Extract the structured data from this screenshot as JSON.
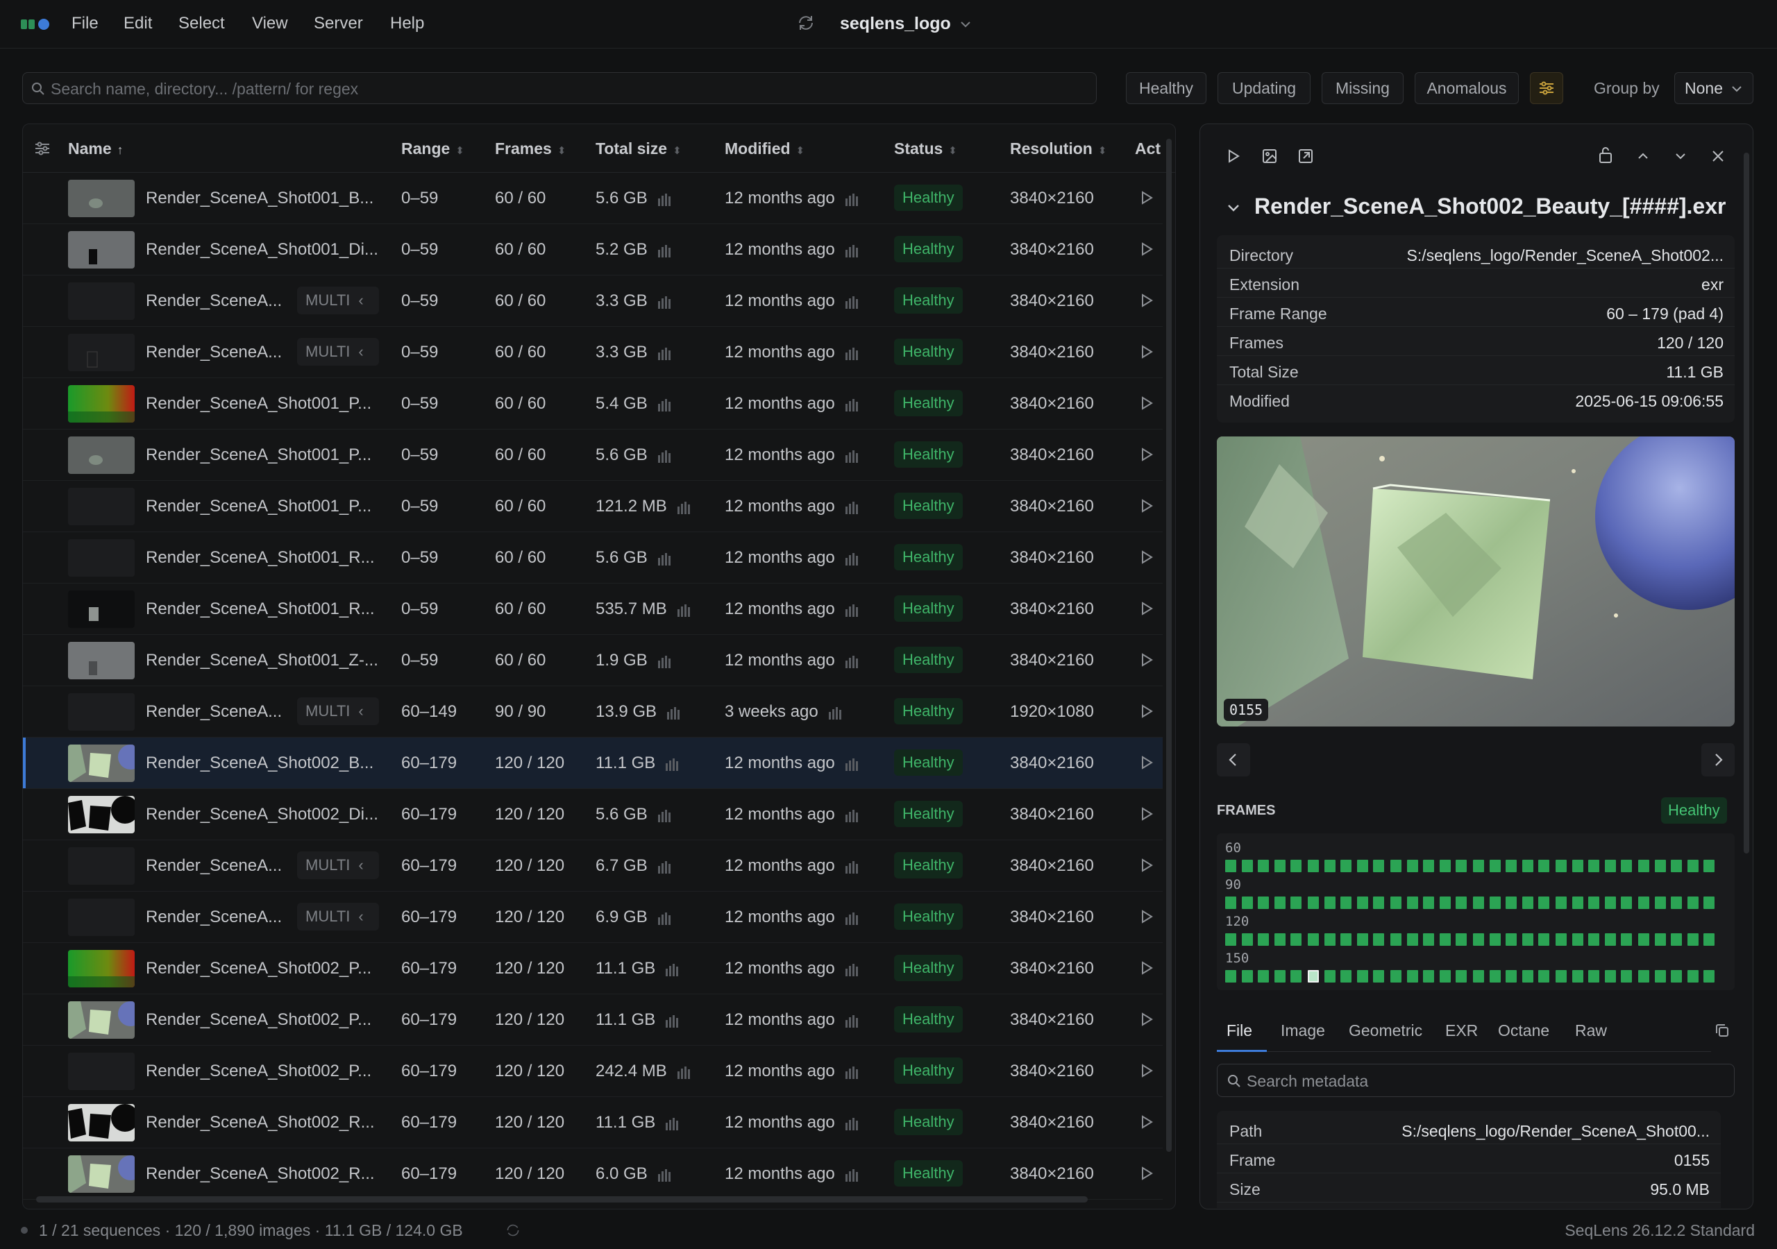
{
  "menubar": {
    "items": [
      "File",
      "Edit",
      "Select",
      "View",
      "Server",
      "Help"
    ],
    "title": "seqlens_logo"
  },
  "toolbar": {
    "search_placeholder": "Search name, directory... /pattern/ for regex",
    "filters": [
      "Healthy",
      "Updating",
      "Missing",
      "Anomalous"
    ],
    "group_by_label": "Group by",
    "group_by_value": "None"
  },
  "table": {
    "columns": [
      "Name",
      "Range",
      "Frames",
      "Total size",
      "Modified",
      "Status",
      "Resolution",
      "Act"
    ],
    "rows": [
      {
        "name": "Render_SceneA_Shot001_B...",
        "multi": "",
        "range": "0–59",
        "frames": "60 / 60",
        "size": "5.6 GB",
        "modified": "12 months ago",
        "status": "Healthy",
        "resolution": "3840×2160",
        "thumb": "orb"
      },
      {
        "name": "Render_SceneA_Shot001_Di...",
        "multi": "",
        "range": "0–59",
        "frames": "60 / 60",
        "size": "5.2 GB",
        "modified": "12 months ago",
        "status": "Healthy",
        "resolution": "3840×2160",
        "thumb": "grey-dark"
      },
      {
        "name": "Render_SceneA...",
        "multi": "MULTI",
        "range": "0–59",
        "frames": "60 / 60",
        "size": "3.3 GB",
        "modified": "12 months ago",
        "status": "Healthy",
        "resolution": "3840×2160",
        "thumb": "black"
      },
      {
        "name": "Render_SceneA...",
        "multi": "MULTI",
        "range": "0–59",
        "frames": "60 / 60",
        "size": "3.3 GB",
        "modified": "12 months ago",
        "status": "Healthy",
        "resolution": "3840×2160",
        "thumb": "black-outline"
      },
      {
        "name": "Render_SceneA_Shot001_P...",
        "multi": "",
        "range": "0–59",
        "frames": "60 / 60",
        "size": "5.4 GB",
        "modified": "12 months ago",
        "status": "Healthy",
        "resolution": "3840×2160",
        "thumb": "rgb"
      },
      {
        "name": "Render_SceneA_Shot001_P...",
        "multi": "",
        "range": "0–59",
        "frames": "60 / 60",
        "size": "5.6 GB",
        "modified": "12 months ago",
        "status": "Healthy",
        "resolution": "3840×2160",
        "thumb": "orb"
      },
      {
        "name": "Render_SceneA_Shot001_P...",
        "multi": "",
        "range": "0–59",
        "frames": "60 / 60",
        "size": "121.2 MB",
        "modified": "12 months ago",
        "status": "Healthy",
        "resolution": "3840×2160",
        "thumb": "black"
      },
      {
        "name": "Render_SceneA_Shot001_R...",
        "multi": "",
        "range": "0–59",
        "frames": "60 / 60",
        "size": "5.6 GB",
        "modified": "12 months ago",
        "status": "Healthy",
        "resolution": "3840×2160",
        "thumb": "black"
      },
      {
        "name": "Render_SceneA_Shot001_R...",
        "multi": "",
        "range": "0–59",
        "frames": "60 / 60",
        "size": "535.7 MB",
        "modified": "12 months ago",
        "status": "Healthy",
        "resolution": "3840×2160",
        "thumb": "black-cube"
      },
      {
        "name": "Render_SceneA_Shot001_Z-...",
        "multi": "",
        "range": "0–59",
        "frames": "60 / 60",
        "size": "1.9 GB",
        "modified": "12 months ago",
        "status": "Healthy",
        "resolution": "3840×2160",
        "thumb": "grey-light"
      },
      {
        "name": "Render_SceneA...",
        "multi": "MULTI",
        "range": "60–149",
        "frames": "90 / 90",
        "size": "13.9 GB",
        "modified": "3 weeks ago",
        "status": "Healthy",
        "resolution": "1920×1080",
        "thumb": "black"
      },
      {
        "name": "Render_SceneA_Shot002_B...",
        "multi": "",
        "range": "60–179",
        "frames": "120 / 120",
        "size": "11.1 GB",
        "modified": "12 months ago",
        "status": "Healthy",
        "resolution": "3840×2160",
        "thumb": "scene",
        "selected": true
      },
      {
        "name": "Render_SceneA_Shot002_Di...",
        "multi": "",
        "range": "60–179",
        "frames": "120 / 120",
        "size": "5.6 GB",
        "modified": "12 months ago",
        "status": "Healthy",
        "resolution": "3840×2160",
        "thumb": "scene-dark"
      },
      {
        "name": "Render_SceneA...",
        "multi": "MULTI",
        "range": "60–179",
        "frames": "120 / 120",
        "size": "6.7 GB",
        "modified": "12 months ago",
        "status": "Healthy",
        "resolution": "3840×2160",
        "thumb": "black"
      },
      {
        "name": "Render_SceneA...",
        "multi": "MULTI",
        "range": "60–179",
        "frames": "120 / 120",
        "size": "6.9 GB",
        "modified": "12 months ago",
        "status": "Healthy",
        "resolution": "3840×2160",
        "thumb": "black"
      },
      {
        "name": "Render_SceneA_Shot002_P...",
        "multi": "",
        "range": "60–179",
        "frames": "120 / 120",
        "size": "11.1 GB",
        "modified": "12 months ago",
        "status": "Healthy",
        "resolution": "3840×2160",
        "thumb": "rgb"
      },
      {
        "name": "Render_SceneA_Shot002_P...",
        "multi": "",
        "range": "60–179",
        "frames": "120 / 120",
        "size": "11.1 GB",
        "modified": "12 months ago",
        "status": "Healthy",
        "resolution": "3840×2160",
        "thumb": "scene"
      },
      {
        "name": "Render_SceneA_Shot002_P...",
        "multi": "",
        "range": "60–179",
        "frames": "120 / 120",
        "size": "242.4 MB",
        "modified": "12 months ago",
        "status": "Healthy",
        "resolution": "3840×2160",
        "thumb": "black"
      },
      {
        "name": "Render_SceneA_Shot002_R...",
        "multi": "",
        "range": "60–179",
        "frames": "120 / 120",
        "size": "11.1 GB",
        "modified": "12 months ago",
        "status": "Healthy",
        "resolution": "3840×2160",
        "thumb": "scene-dark"
      },
      {
        "name": "Render_SceneA_Shot002_R...",
        "multi": "",
        "range": "60–179",
        "frames": "120 / 120",
        "size": "6.0 GB",
        "modified": "12 months ago",
        "status": "Healthy",
        "resolution": "3840×2160",
        "thumb": "scene"
      }
    ]
  },
  "detail": {
    "title": "Render_SceneA_Shot002_Beauty_[####].exr",
    "meta": [
      {
        "k": "Directory",
        "v": "S:/seqlens_logo/Render_SceneA_Shot002..."
      },
      {
        "k": "Extension",
        "v": "exr"
      },
      {
        "k": "Frame Range",
        "v": "60 – 179 (pad 4)"
      },
      {
        "k": "Frames",
        "v": "120 / 120"
      },
      {
        "k": "Total Size",
        "v": "11.1 GB"
      },
      {
        "k": "Modified",
        "v": "2025-06-15 09:06:55"
      }
    ],
    "preview_frame": "0155",
    "frames_heading": "FRAMES",
    "frames_status": "Healthy",
    "frame_rows": [
      {
        "label": "60",
        "count": 30
      },
      {
        "label": "90",
        "count": 30
      },
      {
        "label": "120",
        "count": 30
      },
      {
        "label": "150",
        "count": 30
      }
    ],
    "current_frame_row": 3,
    "current_frame_index": 5,
    "tabs": [
      "File",
      "Image",
      "Geometric",
      "EXR",
      "Octane",
      "Raw"
    ],
    "active_tab": "File",
    "meta_search_placeholder": "Search metadata",
    "file_meta": [
      {
        "k": "Path",
        "v": "S:/seqlens_logo/Render_SceneA_Shot00..."
      },
      {
        "k": "Frame",
        "v": "0155"
      },
      {
        "k": "Size",
        "v": "95.0 MB"
      }
    ]
  },
  "statusbar": {
    "summary": "1 / 21 sequences · 120 / 1,890 images · 11.1 GB / 124.0 GB",
    "version": "SeqLens 26.12.2 Standard"
  },
  "colors": {
    "accent": "#3d7bd8",
    "healthy": "#3fb569",
    "frame_ok": "#2ba454"
  }
}
